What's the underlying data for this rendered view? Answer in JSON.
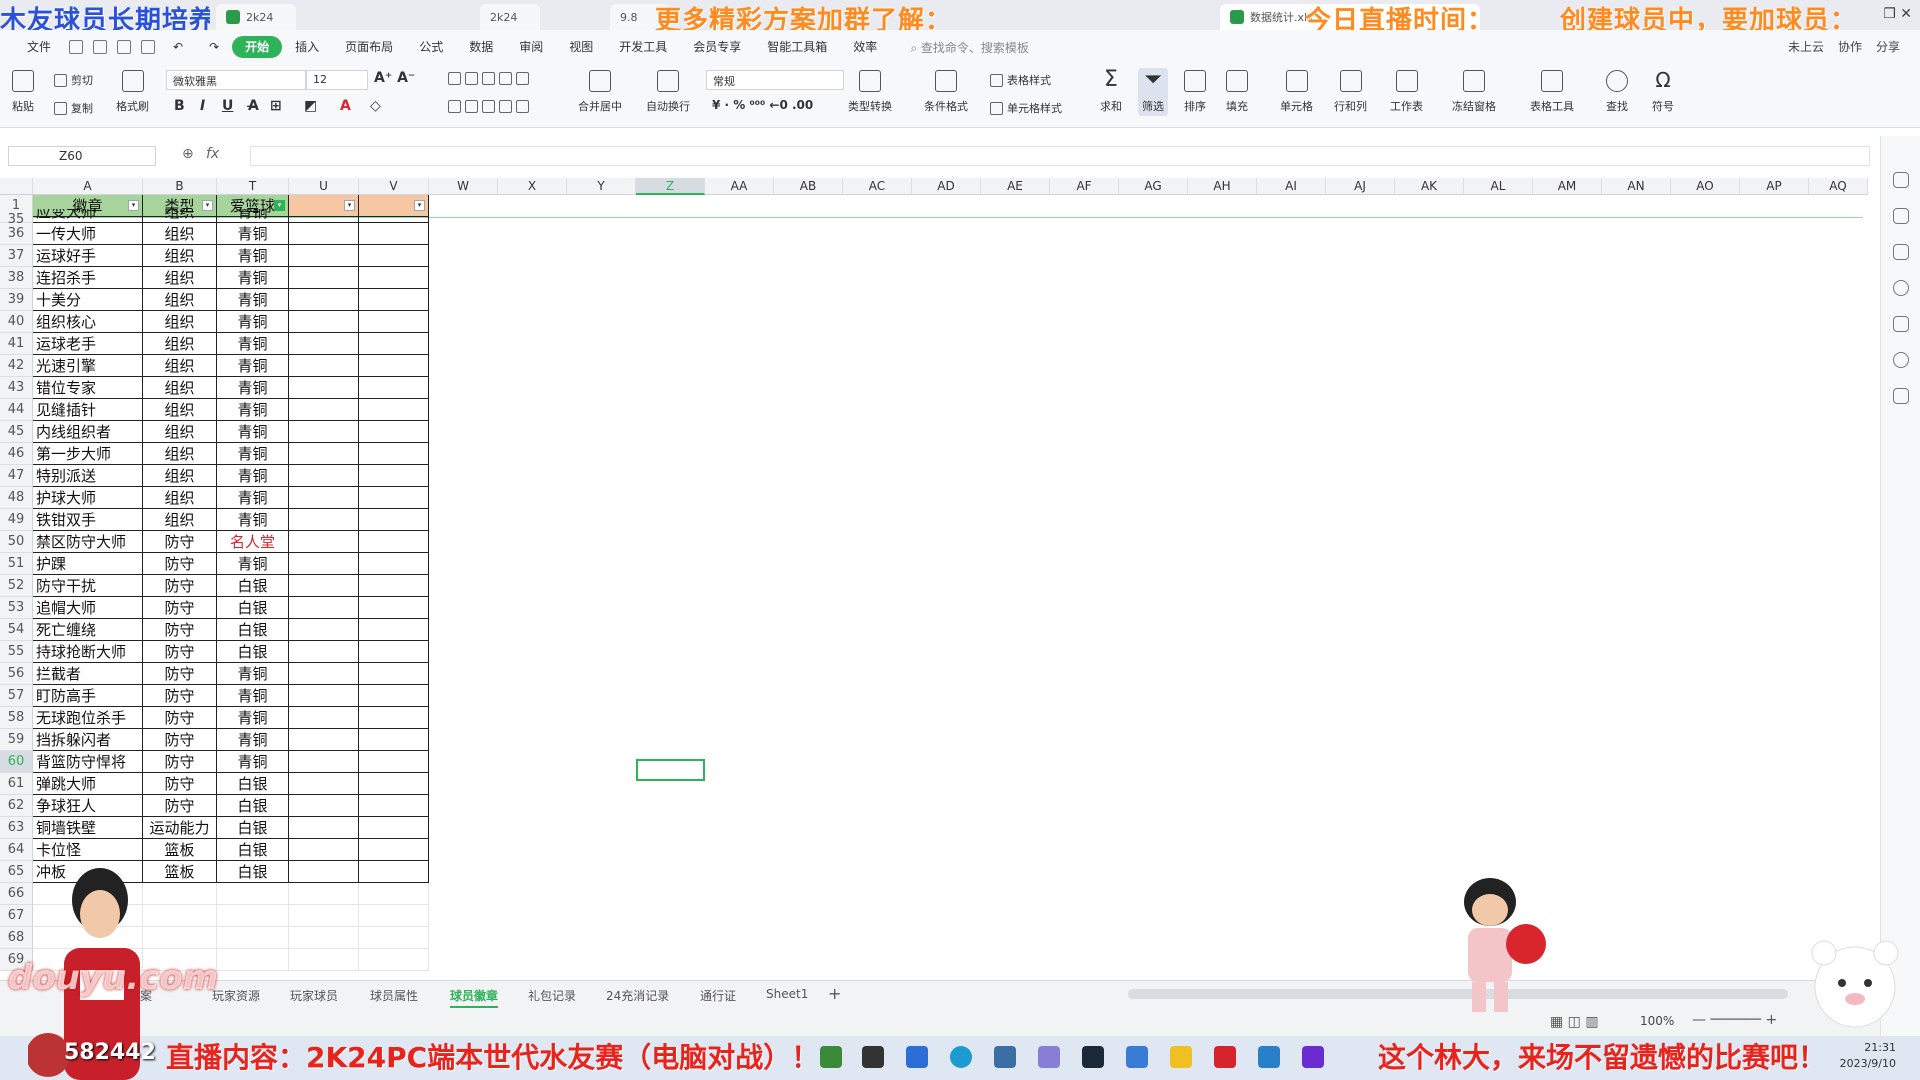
{
  "window": {
    "tabs": [
      {
        "label": "2k24"
      },
      {
        "label": "2k24"
      },
      {
        "label": "9.8"
      },
      {
        "label": "数据统计.xls"
      }
    ],
    "overlay_top_1": "木友球员长期培养，所有比赛全程直播",
    "overlay_top_2": "更多精彩方案加群了解：",
    "overlay_top_3": "今日直播时间：",
    "overlay_top_4": "创建球员中，要加球员："
  },
  "menu": {
    "file": "文件",
    "items": [
      "开始",
      "插入",
      "页面布局",
      "公式",
      "数据",
      "审阅",
      "视图",
      "开发工具",
      "会员专享",
      "智能工具箱",
      "效率"
    ],
    "search_placeholder": "查找命令、搜索模板",
    "right": [
      "未上云",
      "协作",
      "分享"
    ]
  },
  "ribbon": {
    "paste": "粘贴",
    "cut": "剪切",
    "copy": "复制",
    "format_painter": "格式刷",
    "font_name": "微软雅黑",
    "font_size": "12",
    "bold": "B",
    "italic": "I",
    "underline": "U",
    "merge_center": "合并居中",
    "wrap": "自动换行",
    "number_format": "常规",
    "type_convert": "类型转换",
    "cond_format": "条件格式",
    "table_style": "表格样式",
    "cell_style": "单元格样式",
    "sum": "求和",
    "filter": "筛选",
    "sort": "排序",
    "fill": "填充",
    "cell": "单元格",
    "rowcol": "行和列",
    "worksheet": "工作表",
    "freeze": "冻结窗格",
    "table_tools": "表格工具",
    "find": "查找",
    "symbol": "符号"
  },
  "formula_bar": {
    "name_box": "Z60",
    "fx": "fx",
    "formula": ""
  },
  "grid": {
    "visible_columns": [
      "A",
      "B",
      "T",
      "U",
      "V",
      "W",
      "X",
      "Y",
      "Z",
      "AA",
      "AB",
      "AC",
      "AD",
      "AE",
      "AF",
      "AG",
      "AH",
      "AI",
      "AJ",
      "AK",
      "AL",
      "AM",
      "AN",
      "AO",
      "AP",
      "AQ"
    ],
    "selected_column": "Z",
    "selected_row": "60",
    "header_row": {
      "row": "1",
      "A": "徽章",
      "B": "类型",
      "T": "爱篮球"
    },
    "rows": [
      {
        "n": "35",
        "A": "应变大师",
        "B": "组织",
        "T": "青铜"
      },
      {
        "n": "36",
        "A": "一传大师",
        "B": "组织",
        "T": "青铜"
      },
      {
        "n": "37",
        "A": "运球好手",
        "B": "组织",
        "T": "青铜"
      },
      {
        "n": "38",
        "A": "连招杀手",
        "B": "组织",
        "T": "青铜"
      },
      {
        "n": "39",
        "A": "十美分",
        "B": "组织",
        "T": "青铜"
      },
      {
        "n": "40",
        "A": "组织核心",
        "B": "组织",
        "T": "青铜"
      },
      {
        "n": "41",
        "A": "运球老手",
        "B": "组织",
        "T": "青铜"
      },
      {
        "n": "42",
        "A": "光速引擎",
        "B": "组织",
        "T": "青铜"
      },
      {
        "n": "43",
        "A": "错位专家",
        "B": "组织",
        "T": "青铜"
      },
      {
        "n": "44",
        "A": "见缝插针",
        "B": "组织",
        "T": "青铜"
      },
      {
        "n": "45",
        "A": "内线组织者",
        "B": "组织",
        "T": "青铜"
      },
      {
        "n": "46",
        "A": "第一步大师",
        "B": "组织",
        "T": "青铜"
      },
      {
        "n": "47",
        "A": "特别派送",
        "B": "组织",
        "T": "青铜"
      },
      {
        "n": "48",
        "A": "护球大师",
        "B": "组织",
        "T": "青铜"
      },
      {
        "n": "49",
        "A": "铁钳双手",
        "B": "组织",
        "T": "青铜"
      },
      {
        "n": "50",
        "A": "禁区防守大师",
        "B": "防守",
        "T": "名人堂",
        "red": true
      },
      {
        "n": "51",
        "A": "护踝",
        "B": "防守",
        "T": "青铜"
      },
      {
        "n": "52",
        "A": "防守干扰",
        "B": "防守",
        "T": "白银"
      },
      {
        "n": "53",
        "A": "追帽大师",
        "B": "防守",
        "T": "白银"
      },
      {
        "n": "54",
        "A": "死亡缠绕",
        "B": "防守",
        "T": "白银"
      },
      {
        "n": "55",
        "A": "持球抢断大师",
        "B": "防守",
        "T": "白银"
      },
      {
        "n": "56",
        "A": "拦截者",
        "B": "防守",
        "T": "青铜"
      },
      {
        "n": "57",
        "A": "盯防高手",
        "B": "防守",
        "T": "青铜"
      },
      {
        "n": "58",
        "A": "无球跑位杀手",
        "B": "防守",
        "T": "青铜"
      },
      {
        "n": "59",
        "A": "挡拆躲闪者",
        "B": "防守",
        "T": "青铜"
      },
      {
        "n": "60",
        "A": "背篮防守悍将",
        "B": "防守",
        "T": "青铜"
      },
      {
        "n": "61",
        "A": "弹跳大师",
        "B": "防守",
        "T": "白银"
      },
      {
        "n": "62",
        "A": "争球狂人",
        "B": "防守",
        "T": "白银"
      },
      {
        "n": "63",
        "A": "铜墙铁壁",
        "B": "运动能力",
        "T": "白银"
      },
      {
        "n": "64",
        "A": "卡位怪",
        "B": "篮板",
        "T": "白银"
      },
      {
        "n": "65",
        "A": "冲板",
        "B": "篮板",
        "T": "白银"
      },
      {
        "n": "66",
        "A": "",
        "B": "",
        "T": ""
      },
      {
        "n": "67",
        "A": "",
        "B": "",
        "T": ""
      },
      {
        "n": "68",
        "A": "",
        "B": "",
        "T": ""
      },
      {
        "n": "69",
        "A": "",
        "B": "",
        "T": ""
      }
    ]
  },
  "sheets": {
    "tabs": [
      "档案",
      "玩家资源",
      "玩家球员",
      "球员属性",
      "球员徽章",
      "礼包记录",
      "24充消记录",
      "通行证",
      "Sheet1"
    ],
    "active": "球员徽章",
    "add": "+"
  },
  "status": {
    "zoom": "100%"
  },
  "stream": {
    "viewers": "582442",
    "watermark": "douyu.com",
    "taskbar_left": "直播内容：2K24PC端本世代水友赛（电脑对战）！",
    "taskbar_right": "这个林大，来场不留遗憾的比赛吧！",
    "clock_time": "21:31",
    "clock_date": "2023/9/10"
  },
  "colors": {
    "accent": "#2fb35a",
    "header_green": "#a6d49a",
    "header_orange": "#f7c7a3",
    "red_text": "#d9262c"
  }
}
